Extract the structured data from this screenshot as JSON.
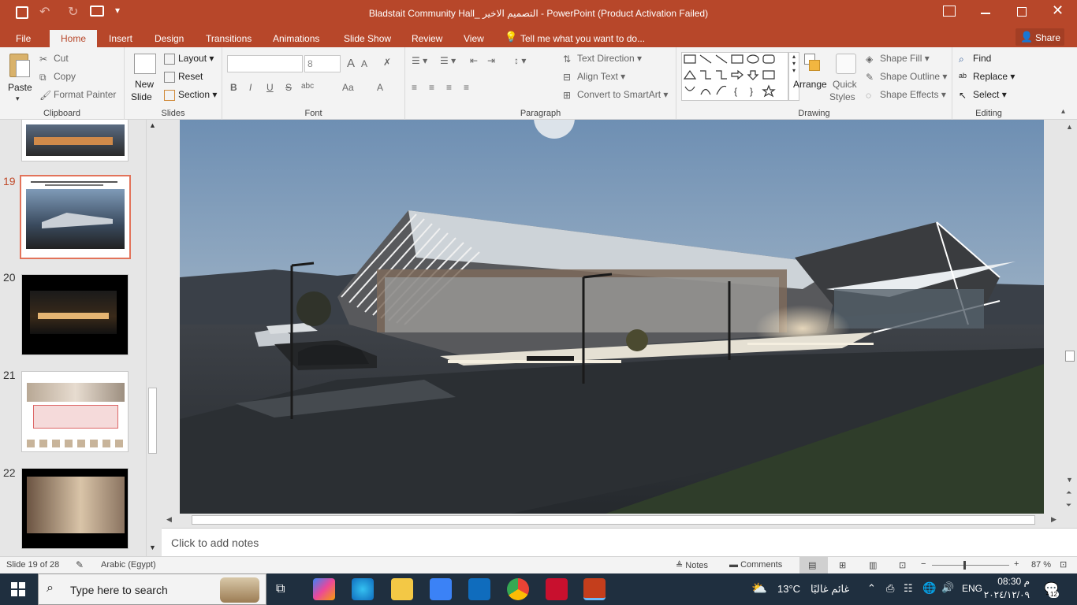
{
  "window": {
    "title": "Bladstait Community Hall_ التصميم الاخير - PowerPoint (Product Activation Failed)"
  },
  "menu": {
    "tabs": [
      "File",
      "Home",
      "Insert",
      "Design",
      "Transitions",
      "Animations",
      "Slide Show",
      "Review",
      "View"
    ],
    "active_tab": "Home",
    "tell_me": "Tell me what you want to do...",
    "share": "Share"
  },
  "ribbon": {
    "clipboard": {
      "label": "Clipboard",
      "paste": "Paste",
      "cut": "Cut",
      "copy": "Copy",
      "format_painter": "Format Painter"
    },
    "slides": {
      "label": "Slides",
      "new_slide_1": "New",
      "new_slide_2": "Slide",
      "layout": "Layout",
      "reset": "Reset",
      "section": "Section"
    },
    "font": {
      "label": "Font",
      "font_name": "",
      "font_size": "8",
      "bold": "B",
      "italic": "I",
      "underline": "U",
      "strike": "S",
      "spacing": "abc",
      "case": "Aa",
      "color": "A"
    },
    "paragraph": {
      "label": "Paragraph",
      "text_direction": "Text Direction",
      "align_text": "Align Text",
      "smartart": "Convert to SmartArt"
    },
    "drawing": {
      "label": "Drawing",
      "arrange": "Arrange",
      "quick_styles_1": "Quick",
      "quick_styles_2": "Styles",
      "shape_fill": "Shape Fill",
      "shape_outline": "Shape Outline",
      "shape_effects": "Shape Effects"
    },
    "editing": {
      "label": "Editing",
      "find": "Find",
      "replace": "Replace",
      "select": "Select"
    }
  },
  "thumbnails": [
    {
      "num": "19",
      "selected": true
    },
    {
      "num": "20",
      "selected": false
    },
    {
      "num": "21",
      "selected": false
    },
    {
      "num": "22",
      "selected": false
    }
  ],
  "notes": {
    "placeholder": "Click to add notes"
  },
  "status": {
    "slide": "Slide 19 of 28",
    "language": "Arabic (Egypt)",
    "notes": "Notes",
    "comments": "Comments",
    "zoom": "87 %"
  },
  "taskbar": {
    "search": "Type here to search",
    "temp": "13°C",
    "weather": "غائم غالبًا",
    "lang": "ENG",
    "time": "08:30 م",
    "date": "٢٠٢٤/١٢/٠٩",
    "badge": "12"
  },
  "colors": {
    "accent": "#b7472a",
    "taskbar": "#1f2f3f"
  }
}
